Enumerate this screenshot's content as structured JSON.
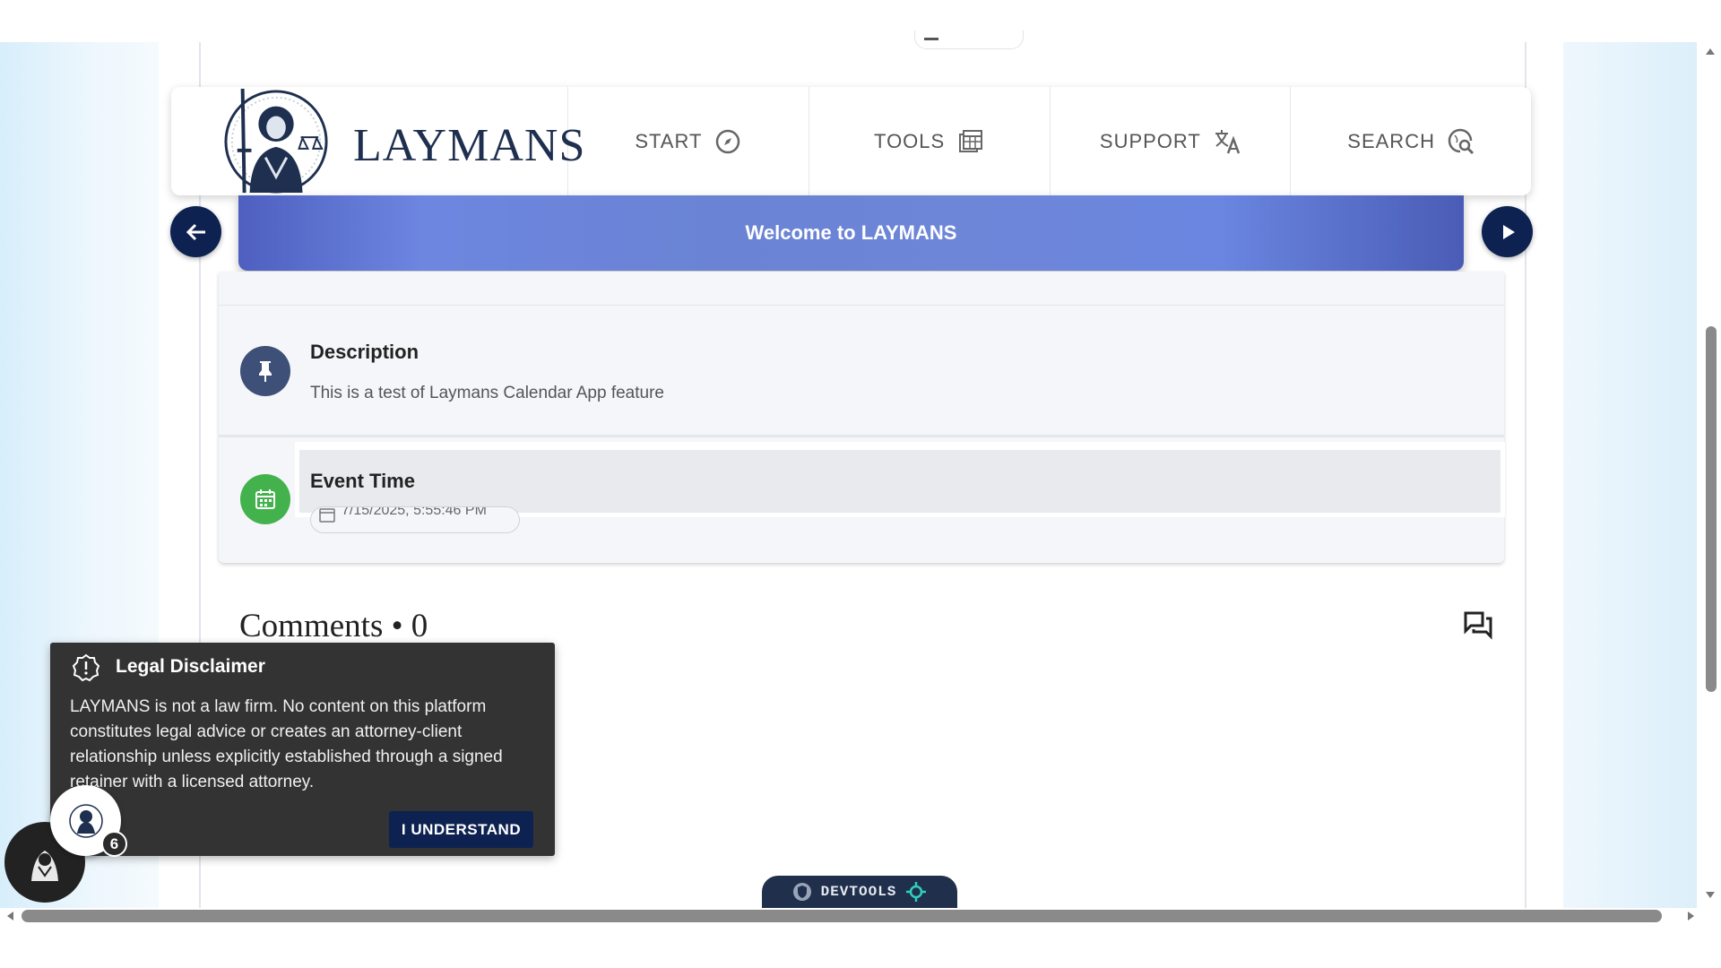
{
  "nav": {
    "brand": "LAYMANS",
    "items": [
      {
        "label": "START",
        "icon": "compass-icon"
      },
      {
        "label": "TOOLS",
        "icon": "table-icon"
      },
      {
        "label": "SUPPORT",
        "icon": "translate-icon"
      },
      {
        "label": "SEARCH",
        "icon": "search-globe-icon"
      }
    ]
  },
  "banner": {
    "text": "Welcome to LAYMANS"
  },
  "event": {
    "description_title": "Description",
    "description_text": "This is a test of Laymans Calendar App feature",
    "time_title": "Event Time",
    "time_value": "7/15/2025, 5:55:46 PM"
  },
  "comments": {
    "title": "Comments • 0"
  },
  "disclaimer": {
    "title": "Legal Disclaimer",
    "body": "LAYMANS is not a law firm. No content on this platform constitutes legal advice or creates an attorney-client relationship unless explicitly established through a signed retainer with a licensed attorney.",
    "button": "I UNDERSTAND"
  },
  "badge": {
    "count": "6"
  },
  "devtools": {
    "label": "DEVTOOLS"
  },
  "colors": {
    "navy": "#0d2250",
    "banner": "#6a83d4",
    "pin_circle": "#3e4f78",
    "calendar_circle": "#43b24c"
  }
}
